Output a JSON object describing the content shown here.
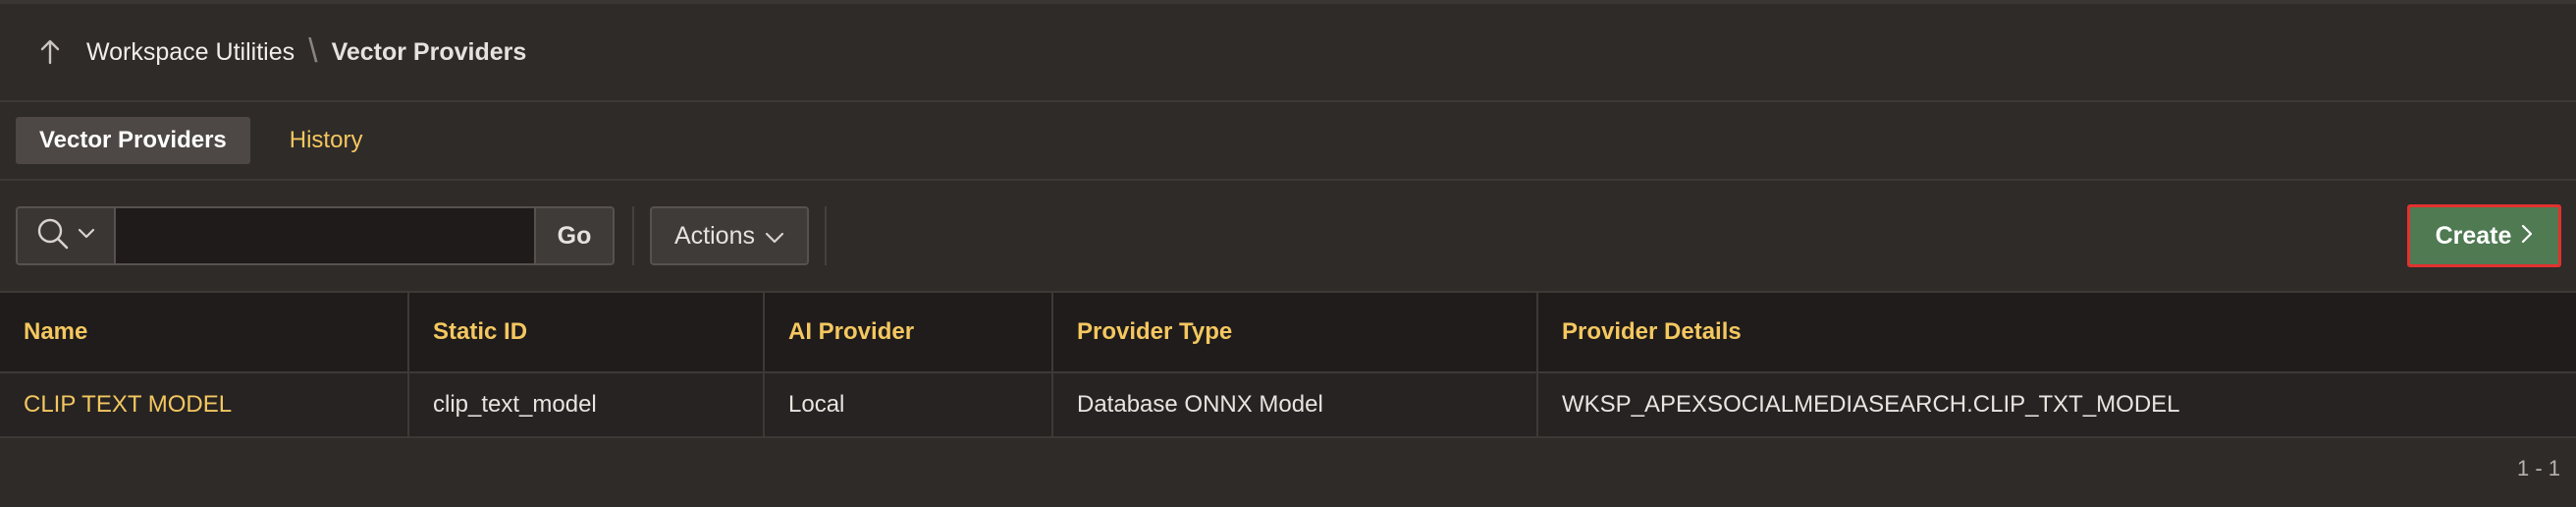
{
  "breadcrumb": {
    "parent": "Workspace Utilities",
    "current": "Vector Providers"
  },
  "tabs": [
    {
      "label": "Vector Providers",
      "active": true
    },
    {
      "label": "History",
      "active": false
    }
  ],
  "toolbar": {
    "search_value": "",
    "go_label": "Go",
    "actions_label": "Actions",
    "create_label": "Create"
  },
  "table": {
    "columns": [
      "Name",
      "Static ID",
      "AI Provider",
      "Provider Type",
      "Provider Details"
    ],
    "rows": [
      [
        "CLIP TEXT MODEL",
        "clip_text_model",
        "Local",
        "Database ONNX Model",
        "WKSP_APEXSOCIALMEDIASEARCH.CLIP_TXT_MODEL"
      ]
    ]
  },
  "pagination": "1 - 1",
  "colors": {
    "accent": "#f4c760",
    "create": "#4f7a52",
    "highlight_border": "#e2322e"
  },
  "icons": {
    "up": "arrow-up-icon",
    "search": "search-icon",
    "chevron": "chevron-down-icon",
    "create": "chevron-right-icon"
  }
}
